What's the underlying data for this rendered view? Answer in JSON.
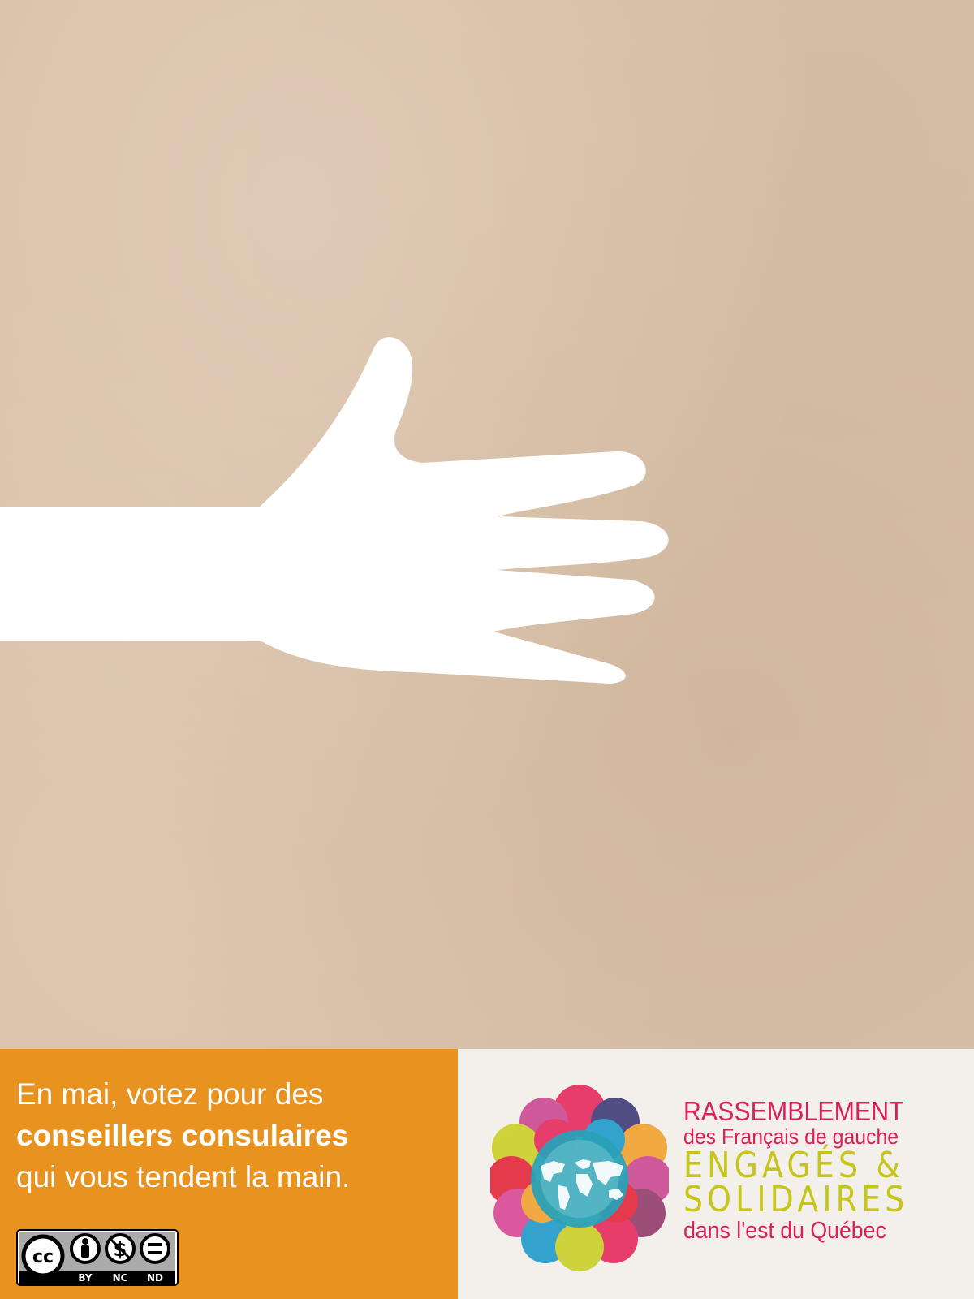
{
  "slogan": {
    "line1": "En mai, votez pour des",
    "line2": "conseillers consulaires",
    "line3": "qui vous tendent la main."
  },
  "license": {
    "cc": "cc",
    "by": "BY",
    "nc": "NC",
    "nd": "ND"
  },
  "organization": {
    "name": "RASSEMBLEMENT",
    "subtitle": "des Français de gauche",
    "tagline1": "ENGAGÉS &",
    "tagline2": "SOLIDAIRES",
    "region": "dans l'est du Québec"
  },
  "colors": {
    "background": "#d8c0a8",
    "hand": "#ffffff",
    "slogan_panel": "#e8921f",
    "logo_panel": "#f3efea",
    "brand_magenta": "#dc1f5a",
    "brand_lime": "#c6c619"
  },
  "icons": {
    "hand": "open-hand-illustration",
    "emblem": "globe-flower-emblem",
    "license": "creative-commons-by-nc-nd-badge"
  }
}
